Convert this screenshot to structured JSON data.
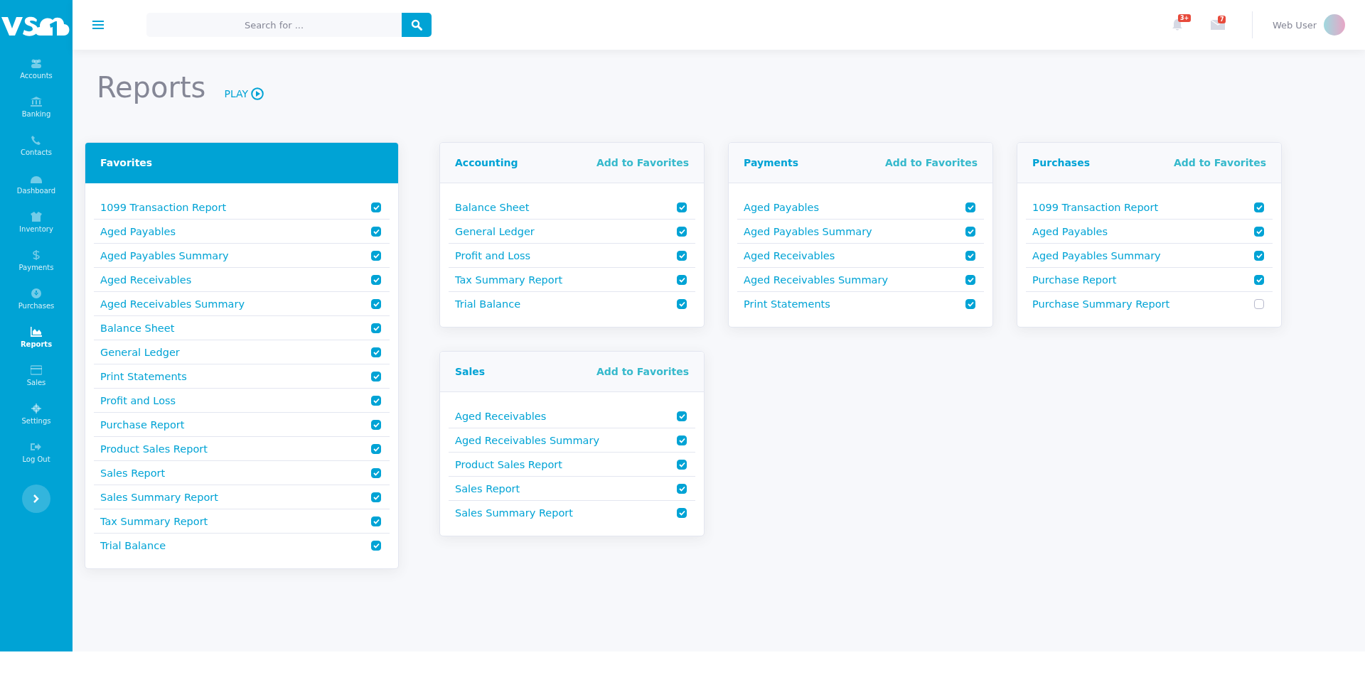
{
  "sidebar": {
    "items": [
      {
        "label": "Accounts",
        "selected": false
      },
      {
        "label": "Banking",
        "selected": false
      },
      {
        "label": "Contacts",
        "selected": false
      },
      {
        "label": "Dashboard",
        "selected": false
      },
      {
        "label": "Inventory",
        "selected": false
      },
      {
        "label": "Payments",
        "selected": false
      },
      {
        "label": "Purchases",
        "selected": false
      },
      {
        "label": "Reports",
        "selected": true
      },
      {
        "label": "Sales",
        "selected": false
      },
      {
        "label": "Settings",
        "selected": false
      },
      {
        "label": "Log Out",
        "selected": false
      }
    ]
  },
  "header": {
    "search": {
      "placeholder": "Search for ..."
    },
    "notifications_badge": "3+",
    "messages_badge": "7",
    "user_name": "Web User"
  },
  "page": {
    "title": "Reports",
    "play_label": "PLAY"
  },
  "cards": [
    {
      "kind": "favorites",
      "title": "Favorites",
      "items": [
        {
          "label": "1099 Transaction Report",
          "checked": true
        },
        {
          "label": "Aged Payables",
          "checked": true
        },
        {
          "label": "Aged Payables Summary",
          "checked": true
        },
        {
          "label": "Aged Receivables",
          "checked": true
        },
        {
          "label": "Aged Receivables Summary",
          "checked": true
        },
        {
          "label": "Balance Sheet",
          "checked": true
        },
        {
          "label": "General Ledger",
          "checked": true
        },
        {
          "label": "Print Statements",
          "checked": true
        },
        {
          "label": "Profit and Loss",
          "checked": true
        },
        {
          "label": "Purchase Report",
          "checked": true
        },
        {
          "label": "Product Sales Report",
          "checked": true
        },
        {
          "label": "Sales Report",
          "checked": true
        },
        {
          "label": "Sales Summary Report",
          "checked": true
        },
        {
          "label": "Tax Summary Report",
          "checked": true
        },
        {
          "label": "Trial Balance",
          "checked": true
        }
      ]
    },
    {
      "kind": "category",
      "title": "Accounting",
      "action": "Add to Favorites",
      "items": [
        {
          "label": "Balance Sheet",
          "checked": true
        },
        {
          "label": "General Ledger",
          "checked": true
        },
        {
          "label": "Profit and Loss",
          "checked": true
        },
        {
          "label": "Tax Summary Report",
          "checked": true
        },
        {
          "label": "Trial Balance",
          "checked": true
        }
      ]
    },
    {
      "kind": "category",
      "title": "Payments",
      "action": "Add to Favorites",
      "items": [
        {
          "label": "Aged Payables",
          "checked": true
        },
        {
          "label": "Aged Payables Summary",
          "checked": true
        },
        {
          "label": "Aged Receivables",
          "checked": true
        },
        {
          "label": "Aged Receivables Summary",
          "checked": true
        },
        {
          "label": "Print Statements",
          "checked": true
        }
      ]
    },
    {
      "kind": "category",
      "title": "Purchases",
      "action": "Add to Favorites",
      "items": [
        {
          "label": "1099 Transaction Report",
          "checked": true
        },
        {
          "label": "Aged Payables",
          "checked": true
        },
        {
          "label": "Aged Payables Summary",
          "checked": true
        },
        {
          "label": "Purchase Report",
          "checked": true
        },
        {
          "label": "Purchase Summary Report",
          "checked": false
        }
      ]
    },
    {
      "kind": "category",
      "title": "Sales",
      "action": "Add to Favorites",
      "items": [
        {
          "label": "Aged Receivables",
          "checked": true
        },
        {
          "label": "Aged Receivables Summary",
          "checked": true
        },
        {
          "label": "Product Sales Report",
          "checked": true
        },
        {
          "label": "Sales Report",
          "checked": true
        },
        {
          "label": "Sales Summary Report",
          "checked": true
        }
      ]
    }
  ]
}
